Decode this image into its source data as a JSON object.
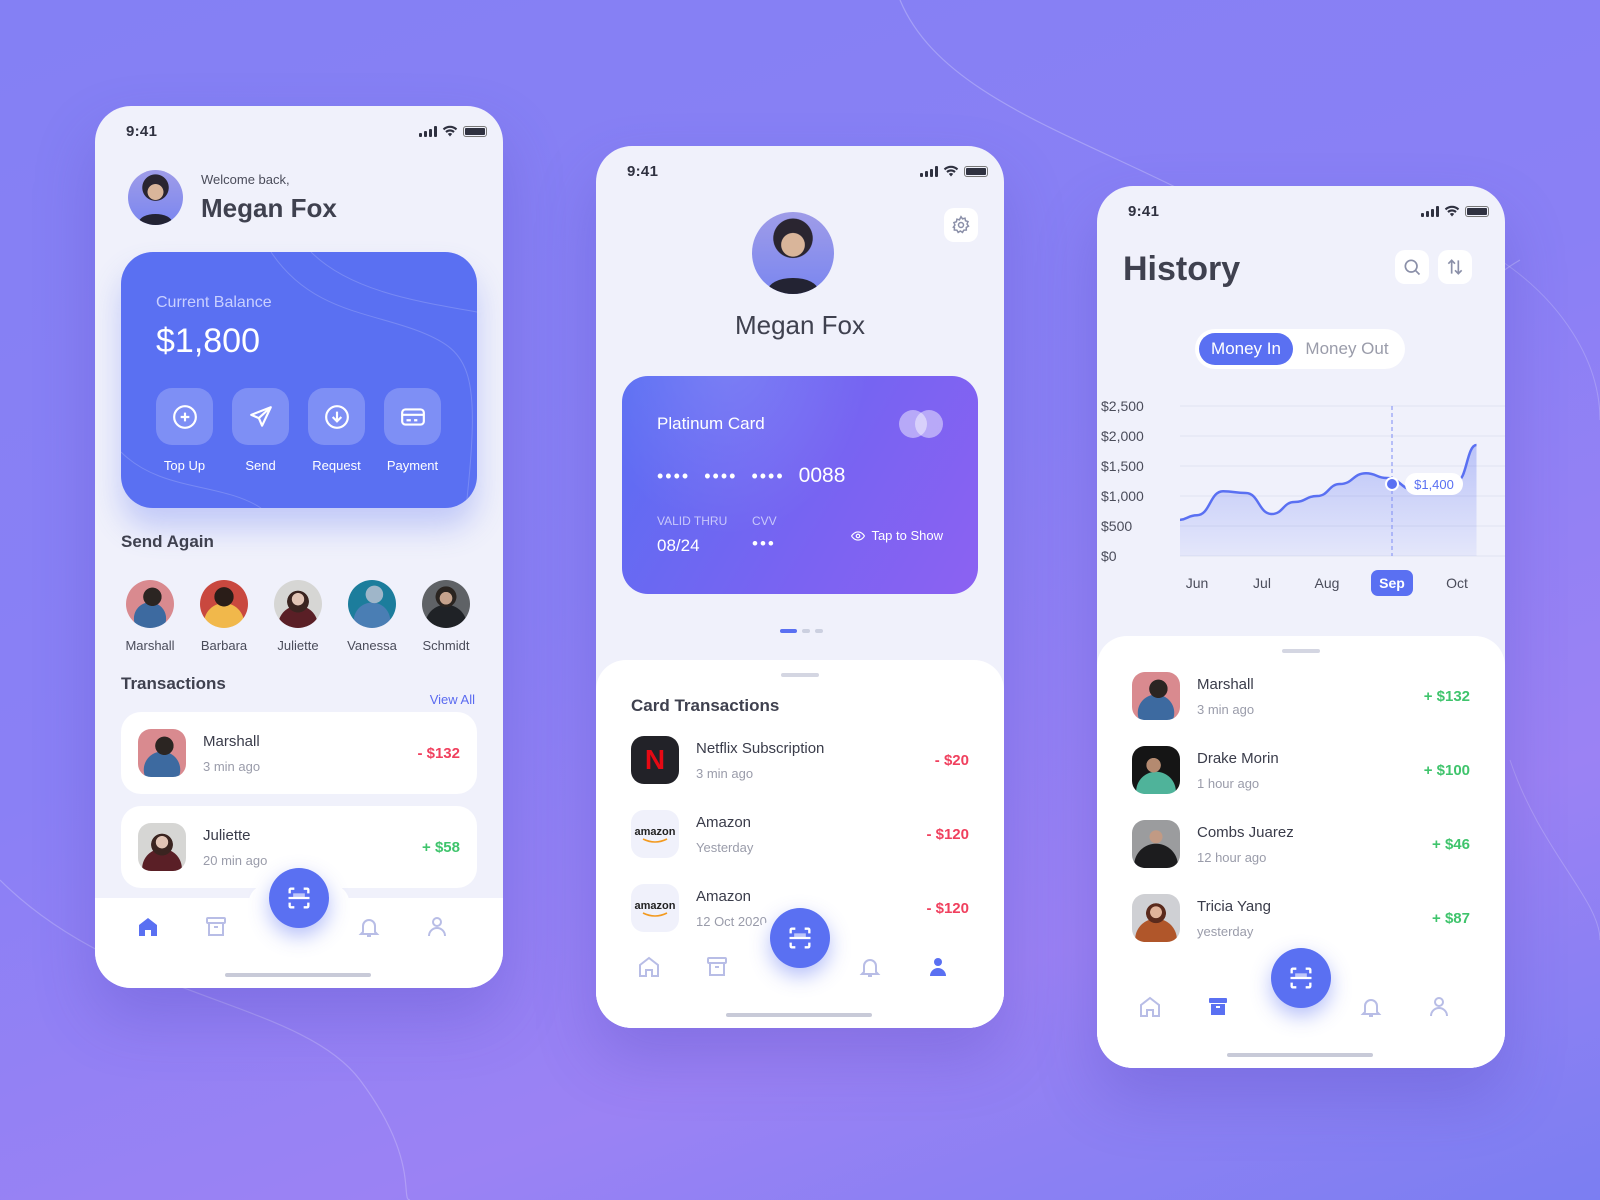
{
  "status_time": "9:41",
  "colors": {
    "accent": "#5a70f2",
    "negative": "#f0405e",
    "positive": "#3fc46c",
    "background": "#8a80f5"
  },
  "home": {
    "greeting": "Welcome back,",
    "user_name": "Megan Fox",
    "balance_label": "Current Balance",
    "balance_value": "$1,800",
    "actions": [
      {
        "label": "Top Up",
        "icon": "plus-circle-icon"
      },
      {
        "label": "Send",
        "icon": "send-icon"
      },
      {
        "label": "Request",
        "icon": "download-circle-icon"
      },
      {
        "label": "Payment",
        "icon": "credit-card-icon"
      }
    ],
    "send_again_title": "Send Again",
    "contacts": [
      "Marshall",
      "Barbara",
      "Juliette",
      "Vanessa",
      "Schmidt"
    ],
    "transactions_title": "Transactions",
    "view_all": "View All",
    "transactions": [
      {
        "name": "Marshall",
        "time": "3 min ago",
        "amount": "- $132",
        "type": "out"
      },
      {
        "name": "Juliette",
        "time": "20 min ago",
        "amount": "+ $58",
        "type": "in"
      }
    ],
    "active_tab": "home"
  },
  "card": {
    "user_name": "Megan Fox",
    "card_name": "Platinum Card",
    "masked_groups": [
      "••••",
      "••••",
      "••••"
    ],
    "last4": "0088",
    "valid_label": "VALID THRU",
    "valid_value": "08/24",
    "cvv_label": "CVV",
    "cvv_value": "•••",
    "tap_to_show": "Tap to Show",
    "page_index": 1,
    "page_count": 3,
    "transactions_title": "Card Transactions",
    "transactions": [
      {
        "name": "Netflix Subscription",
        "time": "3 min ago",
        "amount": "- $20",
        "logo": "netflix"
      },
      {
        "name": "Amazon",
        "time": "Yesterday",
        "amount": "- $120",
        "logo": "amazon"
      },
      {
        "name": "Amazon",
        "time": "12 Oct 2020",
        "amount": "- $120",
        "logo": "amazon"
      }
    ],
    "amazon_logo_text": "amazon",
    "netflix_logo_text": "N",
    "active_tab": "profile"
  },
  "history": {
    "title": "History",
    "segments": [
      "Money In",
      "Money Out"
    ],
    "active_segment": "Money In",
    "transactions": [
      {
        "name": "Marshall",
        "time": "3 min ago",
        "amount": "+ $132"
      },
      {
        "name": "Drake Morin",
        "time": "1 hour ago",
        "amount": "+ $100"
      },
      {
        "name": "Combs Juarez",
        "time": "12 hour ago",
        "amount": "+ $46"
      },
      {
        "name": "Tricia Yang",
        "time": "yesterday",
        "amount": "+ $87"
      }
    ],
    "active_tab": "archive"
  },
  "chart_data": {
    "type": "area",
    "title": "",
    "xlabel": "",
    "ylabel": "",
    "categories": [
      "Jun",
      "Jul",
      "Aug",
      "Sep",
      "Oct"
    ],
    "highlighted_category": "Sep",
    "y_ticks": [
      "$0",
      "$500",
      "$1,000",
      "$1,500",
      "$2,000",
      "$2,500"
    ],
    "ylim": [
      0,
      2500
    ],
    "grid": true,
    "series": [
      {
        "name": "Money In",
        "x": [
          -0.3,
          0,
          0.4,
          0.75,
          1.15,
          1.5,
          1.85,
          2.2,
          2.6,
          2.92,
          3.35,
          3.7,
          4.0,
          4.3
        ],
        "values": [
          600,
          680,
          1080,
          1050,
          700,
          900,
          1000,
          1200,
          1380,
          1300,
          1100,
          1080,
          1250,
          1850
        ]
      }
    ],
    "tooltip": {
      "category": "Sep",
      "value": 1400,
      "label": "$1,400"
    }
  }
}
